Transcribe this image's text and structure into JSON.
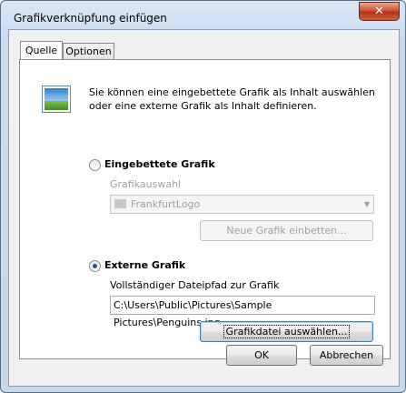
{
  "window": {
    "title": "Grafikverknüpfung einfügen",
    "close_label": "✕"
  },
  "tabs": [
    {
      "label": "Quelle"
    },
    {
      "label": "Optionen"
    }
  ],
  "description": "Sie können eine eingebettete Grafik als Inhalt auswählen oder eine externe Grafik als Inhalt definieren.",
  "embedded": {
    "radio_label": "Eingebettete Grafik",
    "selection_label": "Grafikauswahl",
    "selected_value": "FrankfurtLogo",
    "embed_button": "Neue Grafik einbetten..."
  },
  "external": {
    "radio_label": "Externe Grafik",
    "path_label": "Vollständiger Dateipfad zur Grafik",
    "path_value": "C:\\Users\\Public\\Pictures\\Sample Pictures\\Penguins.jpg",
    "browse_button": "Grafikdatei auswählen..."
  },
  "footer": {
    "ok": "OK",
    "cancel": "Abbrechen"
  },
  "selected_source": "external",
  "icons": {
    "picture": "picture-icon",
    "close": "close-icon",
    "folder": "folder-icon",
    "dropdown": "chevron-down-icon"
  }
}
